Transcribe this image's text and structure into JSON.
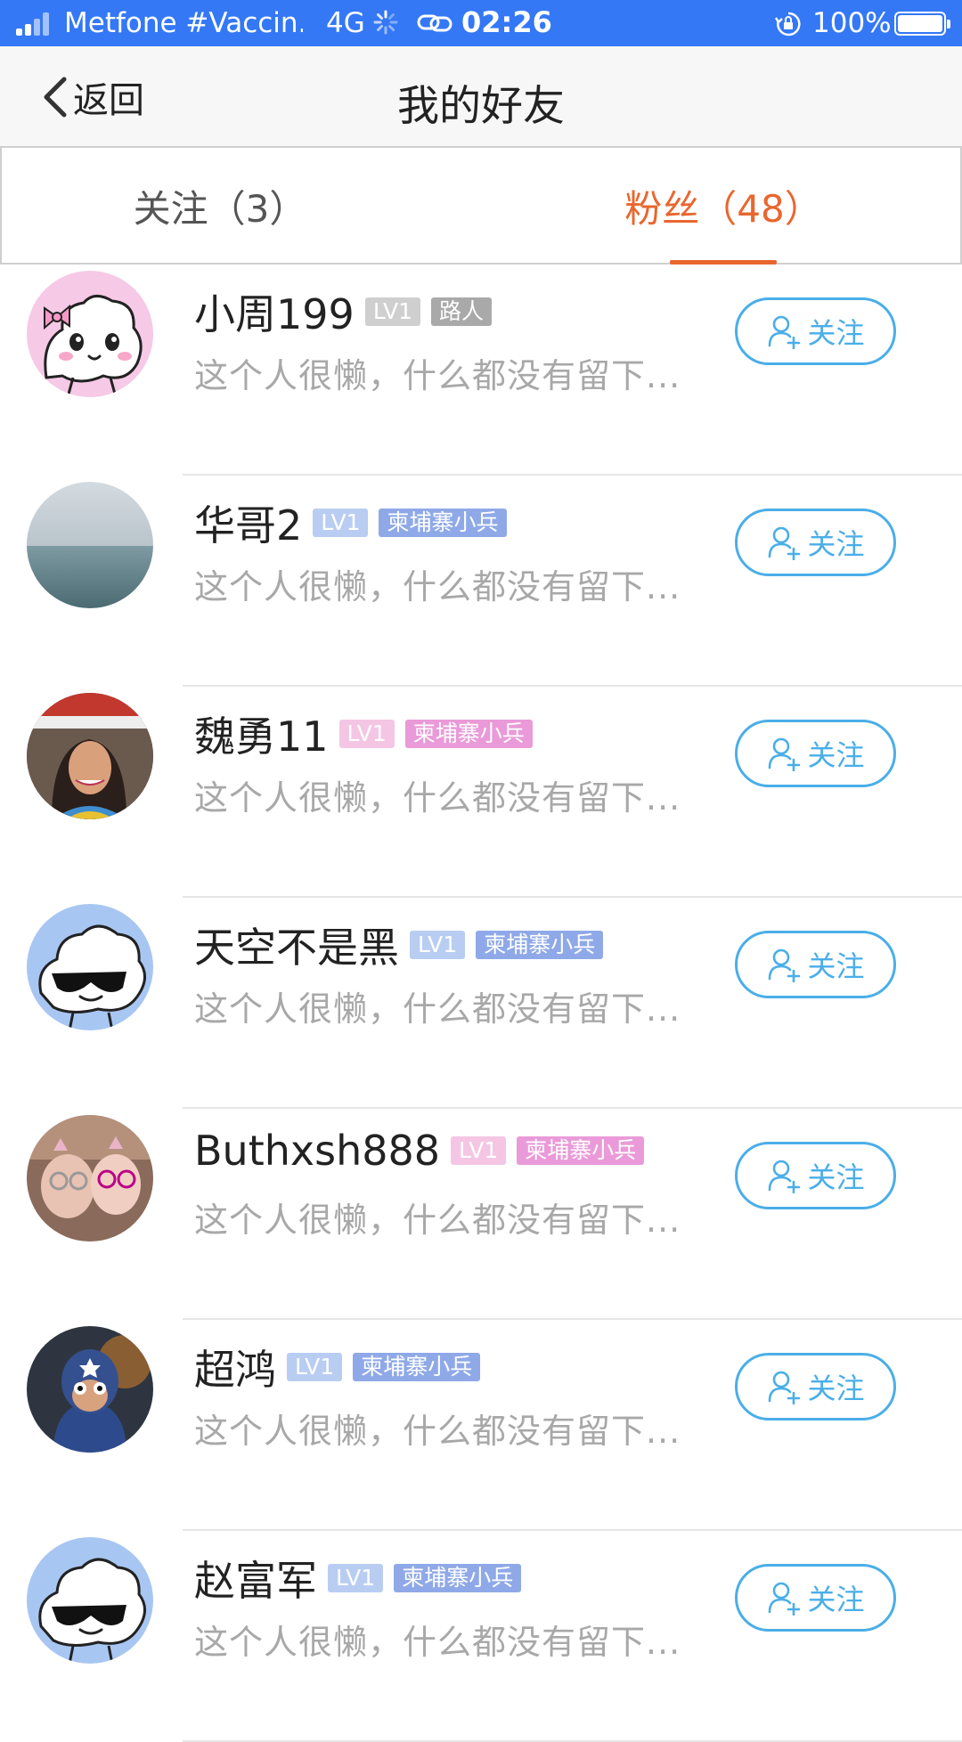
{
  "status_bar": {
    "carrier": "Metfone #Vaccin...",
    "network": "4G",
    "time": "02:26",
    "battery": "100%"
  },
  "nav": {
    "back_label": "返回",
    "title": "我的好友"
  },
  "tabs": {
    "following": "关注（3）",
    "fans": "粉丝（48）",
    "active": "fans"
  },
  "colors": {
    "accent": "#e8672f",
    "follow_blue": "#4aaee8",
    "status_bar": "#3478f6",
    "level_badge_grey": "#cfcfcf",
    "level_badge_blue": "#b9cdf2",
    "level_badge_pink": "#f4c6e4",
    "title_badge_grey": "#a9a9a9",
    "title_badge_blue": "#8fa9e8",
    "title_badge_pink": "#ea9ad8"
  },
  "fans": [
    {
      "name": "小周199",
      "level": "LV1",
      "title": "路人",
      "bio": "这个人很懒，什么都没有留下...",
      "follow_label": "关注",
      "avatar_icon": "pink-bow-cloud-avatar"
    },
    {
      "name": "华哥2",
      "level": "LV1",
      "title": "柬埔寨小兵",
      "bio": "这个人很懒，什么都没有留下...",
      "follow_label": "关注",
      "avatar_icon": "sea-photo-avatar"
    },
    {
      "name": "魏勇11",
      "level": "LV1",
      "title": "柬埔寨小兵",
      "bio": "这个人很懒，什么都没有留下...",
      "follow_label": "关注",
      "avatar_icon": "woman-photo-avatar"
    },
    {
      "name": "天空不是黑",
      "level": "LV1",
      "title": "柬埔寨小兵",
      "bio": "这个人很懒，什么都没有留下...",
      "follow_label": "关注",
      "avatar_icon": "sunglasses-cloud-avatar"
    },
    {
      "name": "Buthxsh888",
      "level": "LV1",
      "title": "柬埔寨小兵",
      "bio": "这个人很懒，什么都没有留下...",
      "follow_label": "关注",
      "avatar_icon": "kids-photo-avatar"
    },
    {
      "name": "超鸿",
      "level": "LV1",
      "title": "柬埔寨小兵",
      "bio": "这个人很懒，什么都没有留下...",
      "follow_label": "关注",
      "avatar_icon": "hero-photo-avatar"
    },
    {
      "name": "赵富军",
      "level": "LV1",
      "title": "柬埔寨小兵",
      "bio": "这个人很懒，什么都没有留下...",
      "follow_label": "关注",
      "avatar_icon": "sunglasses-cloud-avatar"
    }
  ]
}
